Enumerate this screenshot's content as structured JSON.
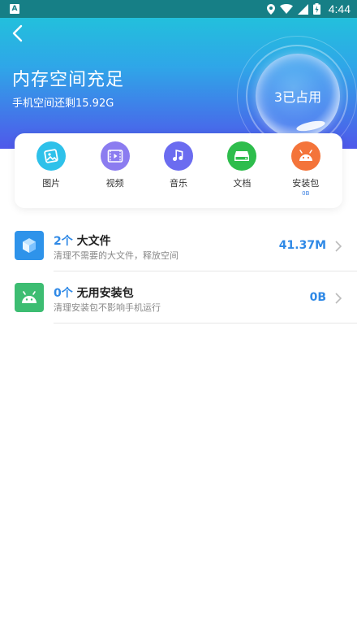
{
  "status_bar": {
    "time": "4:44",
    "notification_icon": "A",
    "icons": [
      "location-icon",
      "wifi-icon",
      "signal-icon",
      "battery-charging-icon"
    ]
  },
  "header": {
    "title": "内存空间充足",
    "subtitle": "手机空间还剩15.92G",
    "bubble_text": "3已占用"
  },
  "categories": [
    {
      "label": "图片",
      "icon": "image-icon",
      "color": "#2ec1ea"
    },
    {
      "label": "视频",
      "icon": "video-icon",
      "color": "#8b7cf0"
    },
    {
      "label": "音乐",
      "icon": "music-icon",
      "color": "#6b6cf0"
    },
    {
      "label": "文档",
      "icon": "document-icon",
      "color": "#2ebd4c"
    },
    {
      "label": "安装包",
      "sub": "0B",
      "icon": "android-icon",
      "color": "#f4743a"
    }
  ],
  "list": [
    {
      "count": "2个",
      "title": "大文件",
      "desc": "清理不需要的大文件，释放空间",
      "value": "41.37M",
      "icon": "cube-icon",
      "color": "#2e93ea"
    },
    {
      "count": "0个",
      "title": "无用安装包",
      "desc": "清理安装包不影响手机运行",
      "value": "0B",
      "icon": "android-icon",
      "color": "#3dbd72"
    }
  ],
  "colors": {
    "accent": "#2f89e6",
    "status_bar": "#167f86"
  }
}
